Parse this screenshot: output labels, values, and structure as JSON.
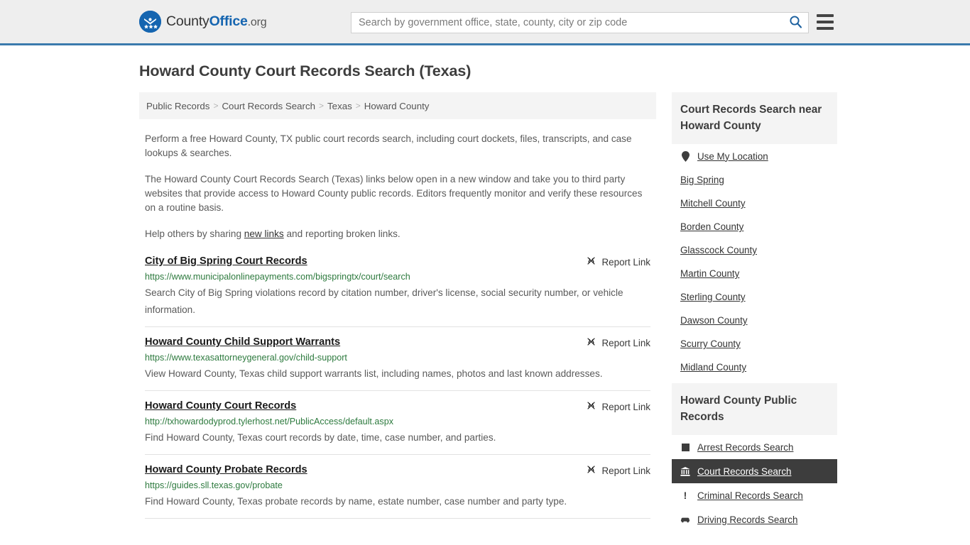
{
  "header": {
    "logo": {
      "part1": "County",
      "part2": "Office",
      "part3": ".org"
    },
    "search_placeholder": "Search by government office, state, county, city or zip code",
    "search_value": "",
    "search_icon": "search-icon",
    "menu_icon": "hamburger-menu-icon"
  },
  "page_title": "Howard County Court Records Search (Texas)",
  "breadcrumb": {
    "separator": ">",
    "items": [
      {
        "label": "Public Records"
      },
      {
        "label": "Court Records Search"
      },
      {
        "label": "Texas"
      },
      {
        "label": "Howard County"
      }
    ]
  },
  "intro": {
    "p1": "Perform a free Howard County, TX public court records search, including court dockets, files, transcripts, and case lookups & searches.",
    "p2": "The Howard County Court Records Search (Texas) links below open in a new window and take you to third party websites that provide access to Howard County public records. Editors frequently monitor and verify these resources on a routine basis.",
    "p3_before": "Help others by sharing ",
    "p3_link": "new links",
    "p3_after": " and reporting broken links."
  },
  "report_link_label": "Report Link",
  "report_link_icon": "broken-link-icon",
  "links": [
    {
      "title": "City of Big Spring Court Records",
      "url": "https://www.municipalonlinepayments.com/bigspringtx/court/search",
      "description": "Search City of Big Spring violations record by citation number, driver's license, social security number, or vehicle information."
    },
    {
      "title": "Howard County Child Support Warrants",
      "url": "https://www.texasattorneygeneral.gov/child-support",
      "description": "View Howard County, Texas child support warrants list, including names, photos and last known addresses."
    },
    {
      "title": "Howard County Court Records",
      "url": "http://txhowardodyprod.tylerhost.net/PublicAccess/default.aspx",
      "description": "Find Howard County, Texas court records by date, time, case number, and parties."
    },
    {
      "title": "Howard County Probate Records",
      "url": "https://guides.sll.texas.gov/probate",
      "description": "Find Howard County, Texas probate records by name, estate number, case number and party type."
    }
  ],
  "sidebar": {
    "nearby": {
      "heading": "Court Records Search near Howard County",
      "items": [
        {
          "label": "Use My Location",
          "icon": "map-pin-icon"
        },
        {
          "label": "Big Spring",
          "icon": ""
        },
        {
          "label": "Mitchell County",
          "icon": ""
        },
        {
          "label": "Borden County",
          "icon": ""
        },
        {
          "label": "Glasscock County",
          "icon": ""
        },
        {
          "label": "Martin County",
          "icon": ""
        },
        {
          "label": "Sterling County",
          "icon": ""
        },
        {
          "label": "Dawson County",
          "icon": ""
        },
        {
          "label": "Scurry County",
          "icon": ""
        },
        {
          "label": "Midland County",
          "icon": ""
        }
      ]
    },
    "public_records": {
      "heading": "Howard County Public Records",
      "items": [
        {
          "label": "Arrest Records Search",
          "icon": "square-icon",
          "active": false
        },
        {
          "label": "Court Records Search",
          "icon": "courthouse-icon",
          "active": true
        },
        {
          "label": "Criminal Records Search",
          "icon": "exclamation-icon",
          "active": false
        },
        {
          "label": "Driving Records Search",
          "icon": "car-icon",
          "active": false
        }
      ]
    }
  },
  "colors": {
    "accent_blue": "#1565b0",
    "header_border": "#3b7aad",
    "url_green": "#2d7a3e",
    "active_bg": "#3d3d3d"
  }
}
